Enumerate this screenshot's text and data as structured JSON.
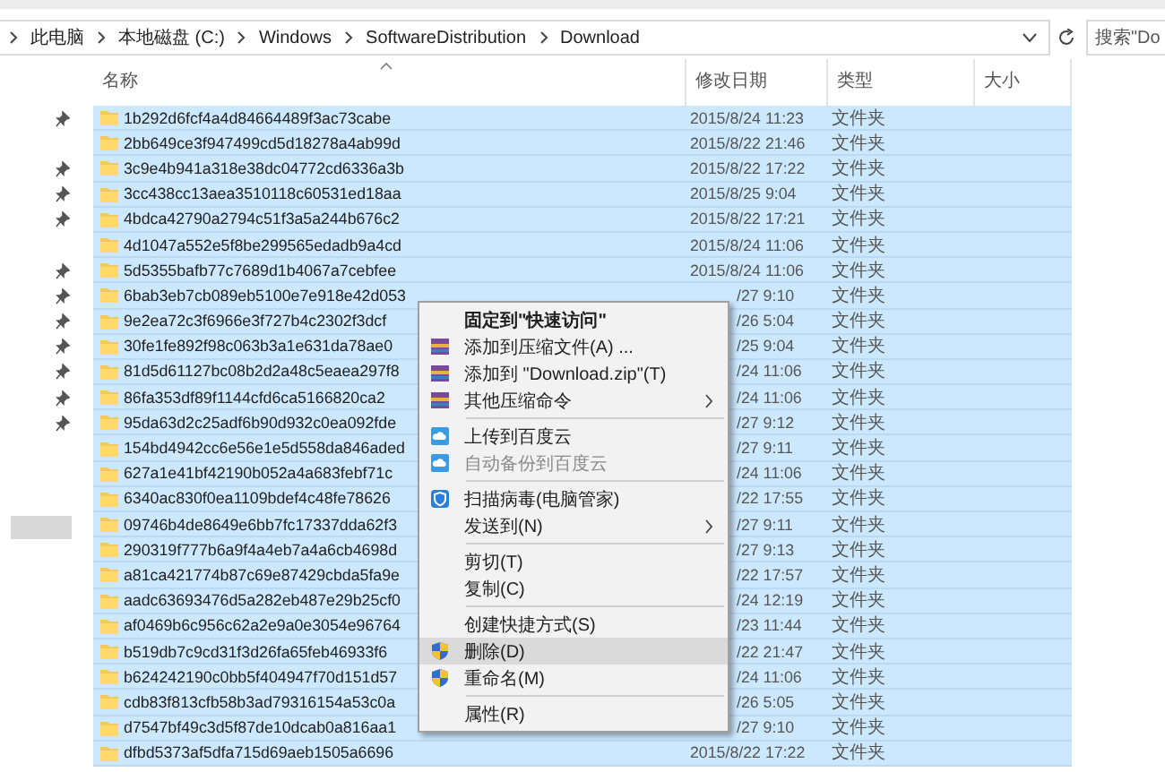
{
  "address_bar": {
    "crumbs": [
      "此电脑",
      "本地磁盘 (C:)",
      "Windows",
      "SoftwareDistribution",
      "Download"
    ]
  },
  "search": {
    "placeholder": "搜索\"Do"
  },
  "columns": [
    "名称",
    "修改日期",
    "类型",
    "大小"
  ],
  "rows": [
    {
      "name": "1b292d6fcf4a4d84664489f3ac73cabe",
      "modified": "2015/8/24 11:23",
      "type": "文件夹",
      "selected": true,
      "covered": false
    },
    {
      "name": "2bb649ce3f947499cd5d18278a4ab99d",
      "modified": "2015/8/22 21:46",
      "type": "文件夹",
      "selected": true,
      "covered": false
    },
    {
      "name": "3c9e4b941a318e38dc04772cd6336a3b",
      "modified": "2015/8/22 17:22",
      "type": "文件夹",
      "selected": true,
      "covered": false
    },
    {
      "name": "3cc438cc13aea3510118c60531ed18aa",
      "modified": "2015/8/25 9:04",
      "type": "文件夹",
      "selected": true,
      "covered": false
    },
    {
      "name": "4bdca42790a2794c51f3a5a244b676c2",
      "modified": "2015/8/22 17:21",
      "type": "文件夹",
      "selected": true,
      "covered": false
    },
    {
      "name": "4d1047a552e5f8be299565edadb9a4cd",
      "modified": "2015/8/24 11:06",
      "type": "文件夹",
      "selected": true,
      "covered": false
    },
    {
      "name": "5d5355bafb77c7689d1b4067a7cebfee",
      "modified": "2015/8/24 11:06",
      "type": "文件夹",
      "selected": true,
      "covered": false
    },
    {
      "name": "6bab3eb7cb089eb5100e7e918e42d053",
      "modified": "/27 9:10",
      "type": "文件夹",
      "selected": true,
      "covered": true
    },
    {
      "name": "9e2ea72c3f6966e3f727b4c2302f3dcf",
      "modified": "/26 5:04",
      "type": "文件夹",
      "selected": true,
      "covered": true
    },
    {
      "name": "30fe1fe892f98c063b3a1e631da78ae0",
      "modified": "/25 9:04",
      "type": "文件夹",
      "selected": true,
      "covered": true
    },
    {
      "name": "81d5d61127bc08b2d2a48c5eaea297f8",
      "modified": "/24 11:06",
      "type": "文件夹",
      "selected": true,
      "covered": true
    },
    {
      "name": "86fa353df89f1144cfd6ca5166820ca2",
      "modified": "/24 11:06",
      "type": "文件夹",
      "selected": true,
      "covered": true
    },
    {
      "name": "95da63d2c25adf6b90d932c0ea092fde",
      "modified": "/27 9:12",
      "type": "文件夹",
      "selected": true,
      "covered": true
    },
    {
      "name": "154bd4942cc6e56e1e5d558da846aded",
      "modified": "/27 9:11",
      "type": "文件夹",
      "selected": true,
      "covered": true
    },
    {
      "name": "627a1e41bf42190b052a4a683febf71c",
      "modified": "/24 11:06",
      "type": "文件夹",
      "selected": true,
      "covered": true
    },
    {
      "name": "6340ac830f0ea1109bdef4c48fe78626",
      "modified": "/22 17:55",
      "type": "文件夹",
      "selected": true,
      "covered": true
    },
    {
      "name": "09746b4de8649e6bb7fc17337dda62f3",
      "modified": "/27 9:11",
      "type": "文件夹",
      "selected": true,
      "covered": true
    },
    {
      "name": "290319f777b6a9f4a4eb7a4a6cb4698d",
      "modified": "/27 9:13",
      "type": "文件夹",
      "selected": true,
      "covered": true
    },
    {
      "name": "a81ca421774b87c69e87429cbda5fa9e",
      "modified": "/22 17:57",
      "type": "文件夹",
      "selected": true,
      "covered": true
    },
    {
      "name": "aadc63693476d5a282eb487e29b25cf0",
      "modified": "/24 12:19",
      "type": "文件夹",
      "selected": true,
      "covered": true
    },
    {
      "name": "af0469b6c956c62a2e9a0e3054e96764",
      "modified": "/23 11:44",
      "type": "文件夹",
      "selected": true,
      "covered": true
    },
    {
      "name": "b519db7c9cd31f3d26fa65feb46933f6",
      "modified": "/22 21:47",
      "type": "文件夹",
      "selected": true,
      "covered": true
    },
    {
      "name": "b624242190c0bb5f404947f70d151d57",
      "modified": "/24 11:06",
      "type": "文件夹",
      "selected": true,
      "covered": true
    },
    {
      "name": "cdb83f813cfb58b3ad79316154a53c0a",
      "modified": "/26 5:05",
      "type": "文件夹",
      "selected": true,
      "covered": true
    },
    {
      "name": "d7547bf49c3d5f87de10dcab0a816aa1",
      "modified": "/27 9:10",
      "type": "文件夹",
      "selected": true,
      "covered": true
    },
    {
      "name": "dfbd5373af5dfa715d69aeb1505a6696",
      "modified": "2015/8/22 17:22",
      "type": "文件夹",
      "selected": true,
      "covered": false
    }
  ],
  "context_menu": {
    "items": [
      {
        "kind": "plain",
        "label": "固定到\"快速访问\"",
        "bold": true,
        "submenu": false,
        "disabled": false,
        "selected": false
      },
      {
        "kind": "archive",
        "label": "添加到压缩文件(A) ...",
        "bold": false,
        "submenu": false,
        "disabled": false,
        "selected": false
      },
      {
        "kind": "archive",
        "label": "添加到 \"Download.zip\"(T)",
        "bold": false,
        "submenu": false,
        "disabled": false,
        "selected": false
      },
      {
        "kind": "archive",
        "label": "其他压缩命令",
        "bold": false,
        "submenu": true,
        "disabled": false,
        "selected": false
      },
      {
        "kind": "separator"
      },
      {
        "kind": "cloud",
        "label": "上传到百度云",
        "bold": false,
        "submenu": false,
        "disabled": false,
        "selected": false
      },
      {
        "kind": "cloud",
        "label": "自动备份到百度云",
        "bold": false,
        "submenu": false,
        "disabled": true,
        "selected": false
      },
      {
        "kind": "separator"
      },
      {
        "kind": "guard",
        "label": "扫描病毒(电脑管家)",
        "bold": false,
        "submenu": false,
        "disabled": false,
        "selected": false
      },
      {
        "kind": "plain",
        "label": "发送到(N)",
        "bold": false,
        "submenu": true,
        "disabled": false,
        "selected": false
      },
      {
        "kind": "separator"
      },
      {
        "kind": "plain",
        "label": "剪切(T)",
        "bold": false,
        "submenu": false,
        "disabled": false,
        "selected": false
      },
      {
        "kind": "plain",
        "label": "复制(C)",
        "bold": false,
        "submenu": false,
        "disabled": false,
        "selected": false
      },
      {
        "kind": "separator"
      },
      {
        "kind": "plain",
        "label": "创建快捷方式(S)",
        "bold": false,
        "submenu": false,
        "disabled": false,
        "selected": false
      },
      {
        "kind": "uac",
        "label": "删除(D)",
        "bold": false,
        "submenu": false,
        "disabled": false,
        "selected": true
      },
      {
        "kind": "uac",
        "label": "重命名(M)",
        "bold": false,
        "submenu": false,
        "disabled": false,
        "selected": false
      },
      {
        "kind": "separator"
      },
      {
        "kind": "plain",
        "label": "属性(R)",
        "bold": false,
        "submenu": false,
        "disabled": false,
        "selected": false
      }
    ]
  }
}
